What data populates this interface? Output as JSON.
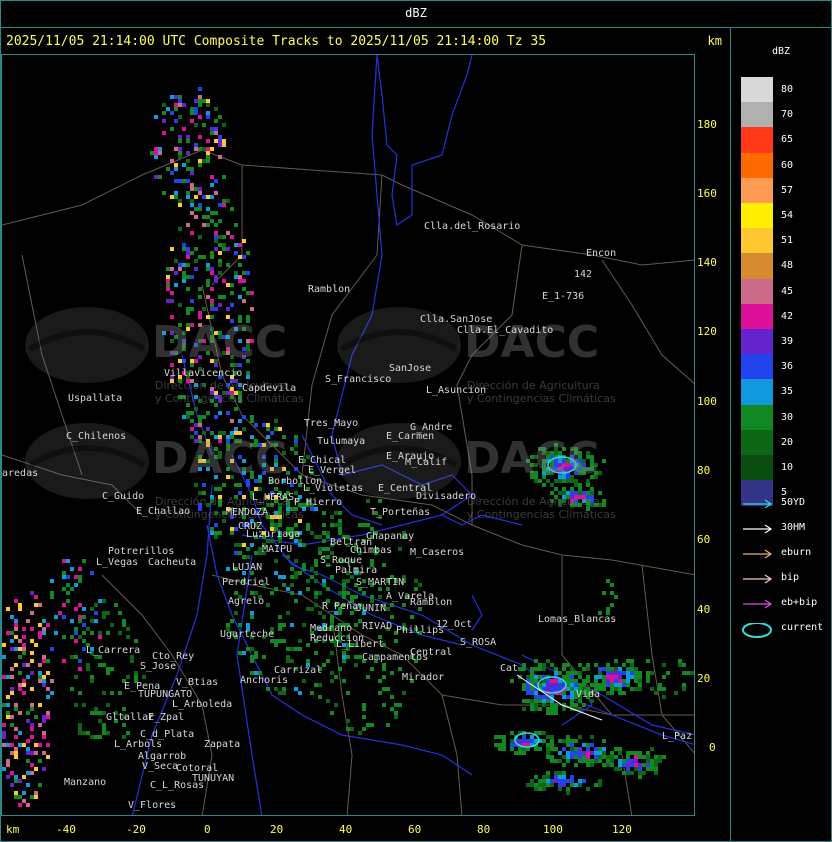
{
  "header": {
    "title": "dBZ"
  },
  "map_title": "2025/11/05 21:14:00 UTC Composite Tracks to 2025/11/05 21:14:00 Tz 35",
  "axis_unit": "km",
  "y_ticks": [
    "180",
    "160",
    "140",
    "120",
    "100",
    "80",
    "60",
    "40",
    "20",
    "0"
  ],
  "x_ticks": [
    "-40",
    "-20",
    "0",
    "20",
    "40",
    "60",
    "80",
    "100",
    "120"
  ],
  "colorbar": {
    "unit": "dBZ",
    "levels": [
      {
        "value": "80",
        "color": "#d8d8d8"
      },
      {
        "value": "70",
        "color": "#b0b0b0"
      },
      {
        "value": "65",
        "color": "#ff3a1a"
      },
      {
        "value": "60",
        "color": "#ff6a00"
      },
      {
        "value": "57",
        "color": "#ff9a55"
      },
      {
        "value": "54",
        "color": "#ffee00"
      },
      {
        "value": "51",
        "color": "#ffc830"
      },
      {
        "value": "48",
        "color": "#d88a30"
      },
      {
        "value": "45",
        "color": "#cc6a8a"
      },
      {
        "value": "42",
        "color": "#dd1199"
      },
      {
        "value": "39",
        "color": "#6622cc"
      },
      {
        "value": "36",
        "color": "#2244ee"
      },
      {
        "value": "35",
        "color": "#1199dd"
      },
      {
        "value": "30",
        "color": "#118822"
      },
      {
        "value": "20",
        "color": "#0d6615"
      },
      {
        "value": "10",
        "color": "#0a4d10"
      },
      {
        "value": "5",
        "color": "#333388"
      }
    ]
  },
  "track_legend": [
    {
      "label": "50YD",
      "color": "#33dddd",
      "kind": "arrow"
    },
    {
      "label": "30HM",
      "color": "#ffffff",
      "kind": "arrow"
    },
    {
      "label": "eburn",
      "color": "#e8b070",
      "kind": "arrow"
    },
    {
      "label": "bip",
      "color": "#ffc8c8",
      "kind": "arrow"
    },
    {
      "label": "eb+bip",
      "color": "#ee44ee",
      "kind": "arrow"
    },
    {
      "label": "current",
      "color": "#33dddd",
      "kind": "ellipse"
    }
  ],
  "watermark": {
    "text": "DACC",
    "subtitle_line1": "Dirección de Agricultura",
    "subtitle_line2": "y Contingencias Climáticas"
  },
  "places": [
    "Clla.del_Rosario",
    "Encon",
    "142",
    "E_1-736",
    "Ramblon",
    "Clla.SanJose",
    "Clla.El_Cavadito",
    "Villavicencio",
    "Uspallata",
    "Capdevila",
    "S_Francisco",
    "SanJose",
    "L_Asuncion",
    "C_Chilenos",
    "Tres_Mayo",
    "Tulumaya",
    "E_Carmen",
    "G_Andre",
    "E_Chical",
    "E_Vergel",
    "E_Araujo",
    "M_Calif",
    "Borbollon",
    "L_Violetas",
    "E_Central",
    "Divisadero",
    "aredas",
    "C_Guido",
    "E_Challao",
    "L_HERAS",
    "P_Hierro",
    "MENDOZA",
    "T_Porteñas",
    "CRUZ",
    "Luzuriaga",
    "Beltran",
    "Chapanay",
    "Potrerillos",
    "Cacheuta",
    "L_Vegas",
    "MAIPU",
    "LUJAN",
    "Chimbas",
    "M_Caseros",
    "S_Roque",
    "Palmira",
    "Perdriel",
    "S_MARTIN",
    "Agrelo",
    "A_Varela",
    "Ramblon",
    "R_Peña",
    "JUNIN",
    "Lomas_Blancas",
    "Ugarteche",
    "RIVAD",
    "Medrano",
    "Reduccion",
    "L_Libert",
    "Phillips",
    "12_Oct",
    "S_ROSA",
    "L_Carrera",
    "Cto_Rey",
    "S_Jose",
    "Carrizal",
    "Campamentos",
    "Central",
    "E_Pena",
    "V_Btias",
    "Anchoris",
    "TUPUNGATO",
    "Mirador",
    "L_Arboleda",
    "Gltallar",
    "E_Zpal",
    "C_d_Plata",
    "L_Arbols",
    "Zapata",
    "Algarrob",
    "V_Seca",
    "Cotoral",
    "Manzano",
    "TUNUYAN",
    "C_L_Rosas",
    "V_Flores",
    "Cat",
    "L_Paz",
    "Vida"
  ]
}
